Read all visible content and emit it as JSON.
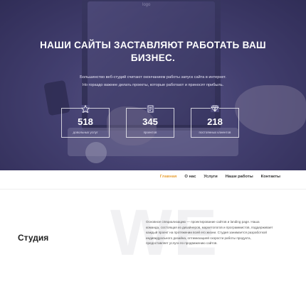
{
  "hero": {
    "title_line1": "НАШИ САЙТЫ ЗАСТАВЛЯЮТ РАБОТАТЬ ВАШ",
    "title_line2": "БИЗНЕС.",
    "subtitle": "Большинство веб-студий считают окончанием работы запуск сайта в интернет. Но гораздо важнее делать проекты, которые работают и приносят прибыль.",
    "screen_logo": "logo"
  },
  "stats": [
    {
      "icon": "star-icon",
      "value": "518",
      "label": "довольных услуг"
    },
    {
      "icon": "document-icon",
      "value": "345",
      "label": "проектов"
    },
    {
      "icon": "diamond-icon",
      "value": "218",
      "label": "постоянных клиентов"
    }
  ],
  "nav": {
    "items": [
      "Главная",
      "О нас",
      "Услуги",
      "Наши работы",
      "Контакты"
    ],
    "active_index": 0,
    "active_color": "#e8a23b"
  },
  "studio": {
    "heading": "Студия",
    "watermark": "WE",
    "text": "Основное специализацию — проектирование сайтов и landing page. Наша команда, состоящая из дизайнеров, маркетологов и программистов, поддерживает каждый проект на протяжении всей его жизни. Студия занимается разработкой индивидуального дизайна, оптимизацией скорости работы продукта, предоставляет услуги по продвижению сайтов."
  }
}
